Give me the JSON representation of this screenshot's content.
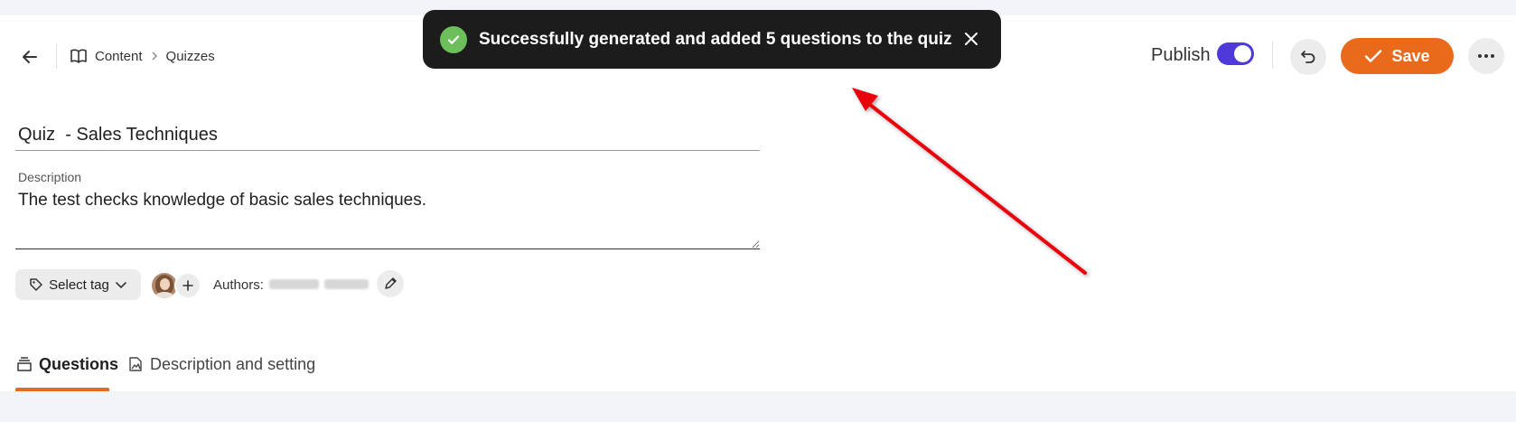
{
  "header": {
    "breadcrumb": [
      {
        "label": "Content"
      },
      {
        "label": "Quizzes"
      }
    ]
  },
  "toast": {
    "message": "Successfully generated and added 5 questions to the quiz"
  },
  "actions": {
    "publish_label": "Publish",
    "publish_on": true,
    "save_label": "Save"
  },
  "form": {
    "title_value": "Quiz  - Sales Techniques",
    "description_label": "Description",
    "description_value": "The test checks knowledge of basic sales techniques.",
    "tag_button_label": "Select tag",
    "authors_label": "Authors:"
  },
  "tabs": [
    {
      "label": "Questions",
      "active": true
    },
    {
      "label": "Description and setting",
      "active": false
    }
  ],
  "colors": {
    "accent": "#ea6a1c",
    "toggle": "#4d3ad8",
    "toast_bg": "#1c1c1c",
    "success": "#6cbf5a",
    "annotation_arrow": "#e8000b"
  }
}
